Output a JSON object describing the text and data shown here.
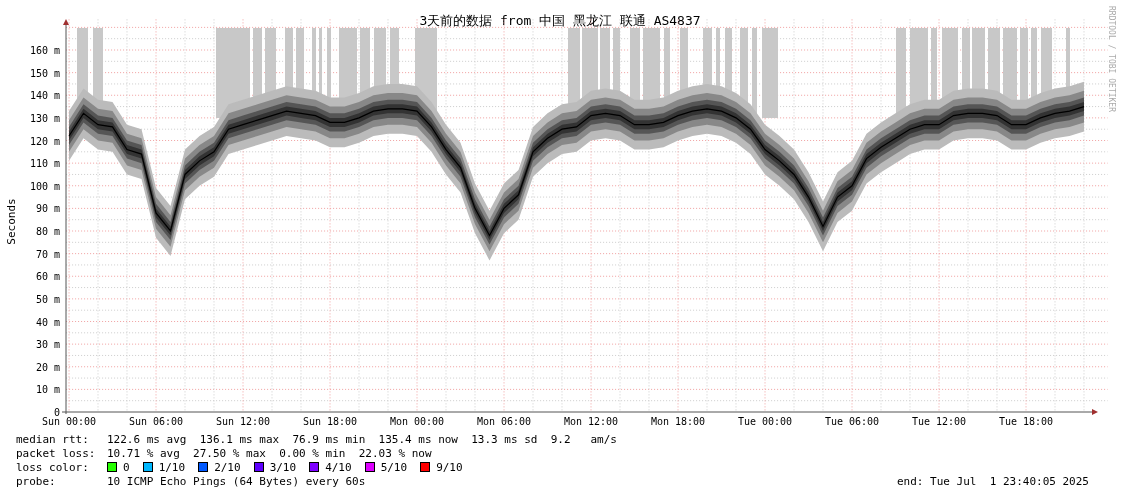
{
  "chart": {
    "chart_data": {
      "type": "line",
      "title": "3天前的数据 from 中国 黑龙江 联通 AS4837",
      "ylabel": "Seconds",
      "categories": [
        "Sun 00:00",
        null,
        null,
        null,
        null,
        null,
        "Sun 06:00",
        null,
        null,
        null,
        null,
        null,
        "Sun 12:00",
        null,
        null,
        null,
        null,
        null,
        "Sun 18:00",
        null,
        null,
        null,
        null,
        null,
        "Mon 00:00",
        null,
        null,
        null,
        null,
        null,
        "Mon 06:00",
        null,
        null,
        null,
        null,
        null,
        "Mon 12:00",
        null,
        null,
        null,
        null,
        null,
        "Mon 18:00",
        null,
        null,
        null,
        null,
        null,
        "Tue 00:00",
        null,
        null,
        null,
        null,
        null,
        "Tue 06:00",
        null,
        null,
        null,
        null,
        null,
        "Tue 12:00",
        null,
        null,
        null,
        null,
        null,
        "Tue 18:00",
        null,
        null,
        null,
        null
      ],
      "ylim": [
        0,
        170
      ],
      "grid": true,
      "yticks": [
        {
          "value": 0,
          "label": "0"
        },
        {
          "value": 10,
          "label": "10 m"
        },
        {
          "value": 20,
          "label": "20 m"
        },
        {
          "value": 30,
          "label": "30 m"
        },
        {
          "value": 40,
          "label": "40 m"
        },
        {
          "value": 50,
          "label": "50 m"
        },
        {
          "value": 60,
          "label": "60 m"
        },
        {
          "value": 70,
          "label": "70 m"
        },
        {
          "value": 80,
          "label": "80 m"
        },
        {
          "value": 90,
          "label": "90 m"
        },
        {
          "value": 100,
          "label": "100 m"
        },
        {
          "value": 110,
          "label": "110 m"
        },
        {
          "value": 120,
          "label": "120 m"
        },
        {
          "value": 130,
          "label": "130 m"
        },
        {
          "value": 140,
          "label": "140 m"
        },
        {
          "value": 150,
          "label": "150 m"
        },
        {
          "value": 160,
          "label": "160 m"
        }
      ],
      "series": [
        {
          "color": "#000000",
          "values": [
            122,
            132,
            127,
            126,
            116,
            114,
            88,
            80,
            105,
            111,
            115,
            125,
            127,
            129,
            131,
            133,
            132,
            131,
            128,
            128,
            130,
            133,
            134,
            134,
            133,
            126,
            116,
            108,
            90,
            78,
            90,
            96,
            115,
            121,
            125,
            126,
            131,
            132,
            131,
            127,
            127,
            128,
            131,
            133,
            134,
            133,
            130,
            125,
            116,
            111,
            105,
            95,
            82,
            95,
            100,
            112,
            117,
            121,
            125,
            127,
            127,
            131,
            132,
            132,
            131,
            127,
            127,
            130,
            132,
            133,
            135
          ]
        }
      ]
    },
    "credit": "RRDTOOL / TOBI OETIKER"
  },
  "stats": [
    {
      "label": "median rtt:",
      "value": "122.6 ms avg  136.1 ms max  76.9 ms min  135.4 ms now  13.3 ms sd  9.2   am/s"
    },
    {
      "label": "packet loss:",
      "value": "10.71 % avg  27.50 % max  0.00 % min  22.03 % now"
    }
  ],
  "loss_legend": {
    "label": "loss color:",
    "items": [
      {
        "label": "0",
        "color": "#26ff00"
      },
      {
        "label": "1/10",
        "color": "#00b8ff"
      },
      {
        "label": "2/10",
        "color": "#0059ff"
      },
      {
        "label": "3/10",
        "color": "#5e00ff"
      },
      {
        "label": "4/10",
        "color": "#7e00ff"
      },
      {
        "label": "5/10",
        "color": "#dd00ff"
      },
      {
        "label": "9/10",
        "color": "#ff0000"
      }
    ]
  },
  "probe": {
    "label": "probe:",
    "value": "10 ICMP Echo Pings (64 Bytes) every 60s"
  },
  "end": "end: Tue Jul  1 23:40:05 2025"
}
